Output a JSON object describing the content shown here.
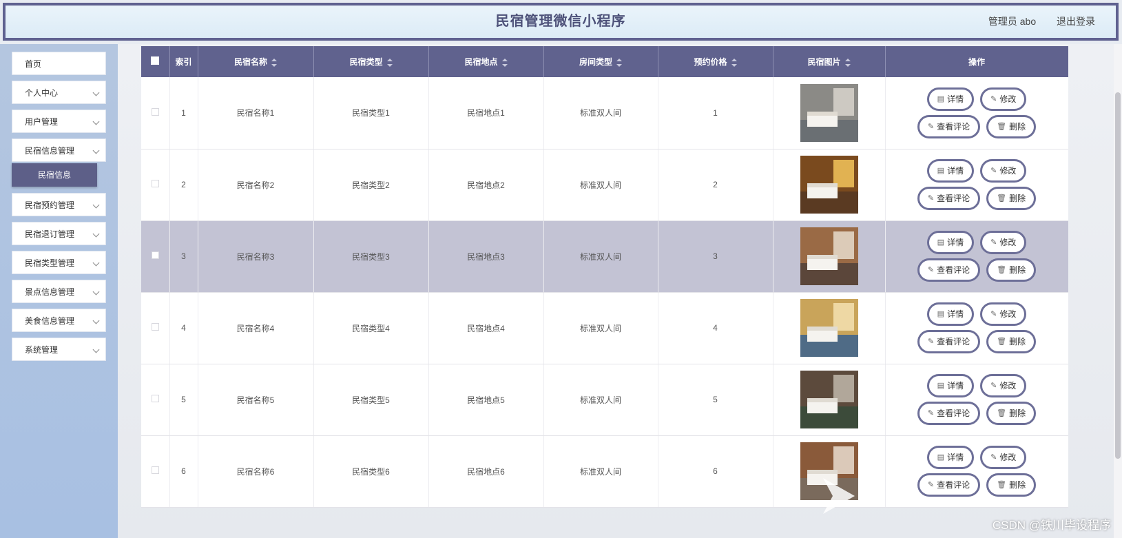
{
  "header": {
    "title": "民宿管理微信小程序",
    "user": "管理员 abo",
    "logout": "退出登录"
  },
  "sidebar": {
    "items": [
      {
        "label": "首页",
        "has_arrow": false
      },
      {
        "label": "个人中心",
        "has_arrow": true
      },
      {
        "label": "用户管理",
        "has_arrow": true
      },
      {
        "label": "民宿信息管理",
        "has_arrow": true
      },
      {
        "label": "民宿信息",
        "sub": true
      },
      {
        "label": "民宿预约管理",
        "has_arrow": true
      },
      {
        "label": "民宿退订管理",
        "has_arrow": true
      },
      {
        "label": "民宿类型管理",
        "has_arrow": true
      },
      {
        "label": "景点信息管理",
        "has_arrow": true
      },
      {
        "label": "美食信息管理",
        "has_arrow": true
      },
      {
        "label": "系统管理",
        "has_arrow": true
      }
    ]
  },
  "table": {
    "columns": [
      "索引",
      "民宿名称",
      "民宿类型",
      "民宿地点",
      "房间类型",
      "预约价格",
      "民宿图片",
      "操作"
    ],
    "rows": [
      {
        "index": "1",
        "name": "民宿名称1",
        "type": "民宿类型1",
        "location": "民宿地点1",
        "room": "标准双人间",
        "price": "1",
        "img": "room1"
      },
      {
        "index": "2",
        "name": "民宿名称2",
        "type": "民宿类型2",
        "location": "民宿地点2",
        "room": "标准双人间",
        "price": "2",
        "img": "room2"
      },
      {
        "index": "3",
        "name": "民宿名称3",
        "type": "民宿类型3",
        "location": "民宿地点3",
        "room": "标准双人间",
        "price": "3",
        "img": "room3"
      },
      {
        "index": "4",
        "name": "民宿名称4",
        "type": "民宿类型4",
        "location": "民宿地点4",
        "room": "标准双人间",
        "price": "4",
        "img": "room4"
      },
      {
        "index": "5",
        "name": "民宿名称5",
        "type": "民宿类型5",
        "location": "民宿地点5",
        "room": "标准双人间",
        "price": "5",
        "img": "room5"
      },
      {
        "index": "6",
        "name": "民宿名称6",
        "type": "民宿类型6",
        "location": "民宿地点6",
        "room": "标准双人间",
        "price": "6",
        "img": "room6"
      }
    ],
    "highlighted_row": 3,
    "actions": {
      "detail": "详情",
      "edit": "修改",
      "comments": "查看评论",
      "delete": "删除"
    }
  },
  "watermark": "CSDN @铁川毕设程序",
  "colors": {
    "accent": "#60628e",
    "highlight": "#c3c3d4"
  }
}
